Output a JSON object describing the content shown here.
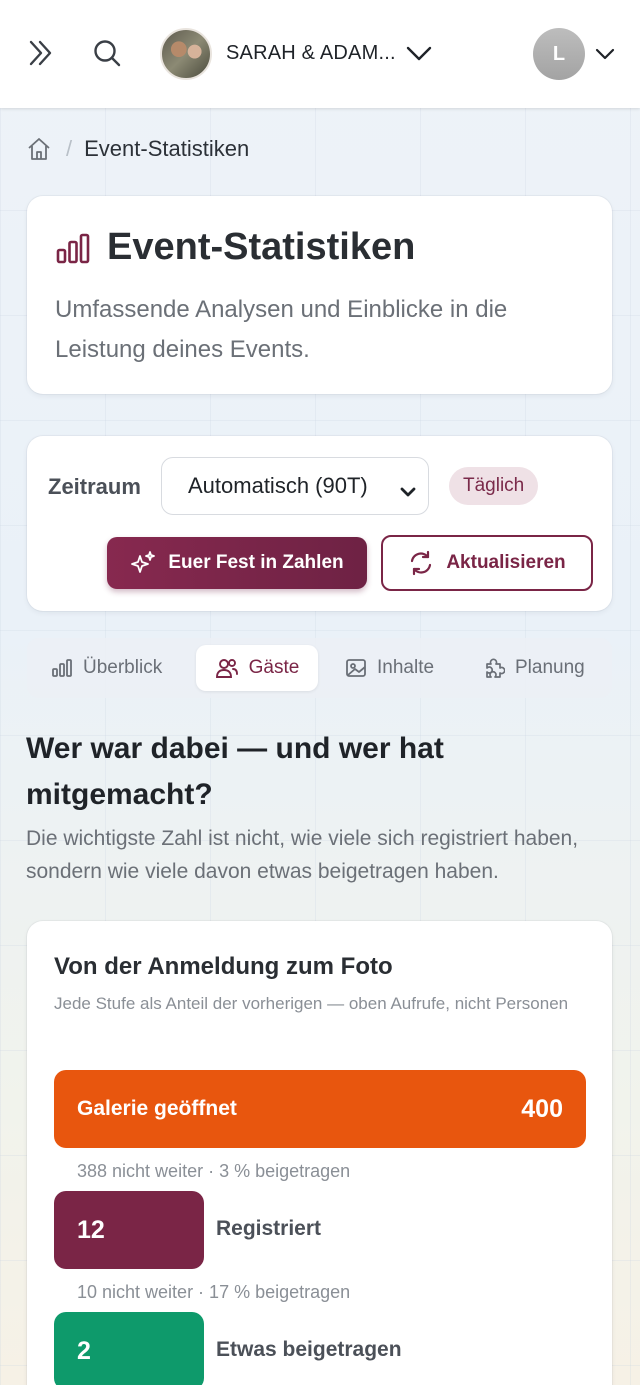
{
  "topbar": {
    "event_name": "SARAH & ADAM...",
    "user_initial": "L"
  },
  "breadcrumb": {
    "current": "Event-Statistiken"
  },
  "hero": {
    "title": "Event-Statistiken",
    "subtitle": "Umfassende Analysen und Einblicke in die Leistung deines Events."
  },
  "controls": {
    "period_label": "Zeitraum",
    "period_value": "Automatisch (90T)",
    "interval_badge": "Täglich",
    "primary_button": "Euer Fest in Zahlen",
    "refresh_button": "Aktualisieren"
  },
  "tabs": [
    {
      "label": "Überblick",
      "icon": "bar-chart-icon",
      "active": false
    },
    {
      "label": "Gäste",
      "icon": "users-icon",
      "active": true
    },
    {
      "label": "Inhalte",
      "icon": "image-icon",
      "active": false
    },
    {
      "label": "Planung",
      "icon": "puzzle-icon",
      "active": false
    }
  ],
  "section": {
    "title": "Wer war dabei — und wer hat mitgemacht?",
    "subtitle": "Die wichtigste Zahl ist nicht, wie viele sich registriert haben, sondern wie viele davon etwas beigetragen haben."
  },
  "funnel": {
    "title": "Von der Anmeldung zum Foto",
    "subtitle": "Jede Stufe als Anteil der vorherigen — oben Aufrufe, nicht Personen",
    "steps": [
      {
        "label": "Galerie geöffnet",
        "value": "400",
        "color": "#e8560e"
      },
      {
        "label": "Registriert",
        "value": "12",
        "color": "#7a2546",
        "drop_text": "388 nicht weiter · 3 % beigetragen"
      },
      {
        "label": "Etwas beigetragen",
        "value": "2",
        "color": "#0e9a6b",
        "drop_text": "10 nicht weiter · 17 % beigetragen"
      }
    ]
  },
  "colors": {
    "brand": "#7a2546",
    "accent_orange": "#e8560e",
    "accent_green": "#0e9a6b"
  }
}
